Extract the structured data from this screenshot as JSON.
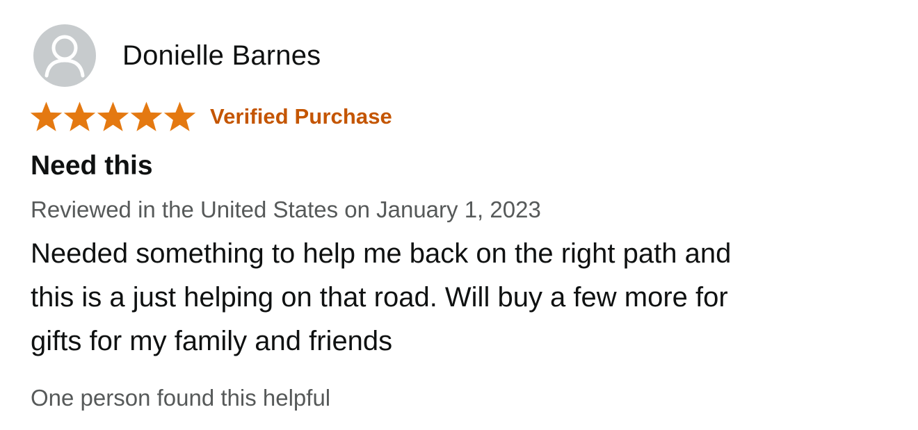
{
  "review": {
    "profile": {
      "avatar_icon": "person-silhouette-icon",
      "name": "Donielle Barnes"
    },
    "rating": {
      "stars": 5,
      "max_stars": 5,
      "star_color": "#e47911",
      "verified_label": "Verified Purchase",
      "verified_color": "#c45500"
    },
    "title": "Need this",
    "date_text": "Reviewed in the United States on January 1, 2023",
    "body_lines": [
      "Needed something to help me back on the right path and",
      "this is a just helping on that road. Will buy a few more for",
      "gifts for my family and friends"
    ],
    "helpful_text": "One person found this helpful"
  }
}
